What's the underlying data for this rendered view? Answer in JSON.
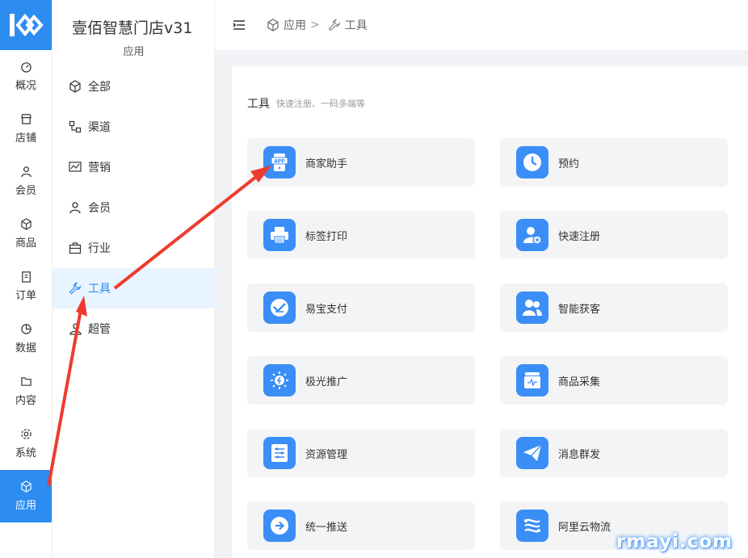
{
  "rail": {
    "items": [
      {
        "label": "概况",
        "icon": "dashboard-icon"
      },
      {
        "label": "店铺",
        "icon": "store-icon"
      },
      {
        "label": "会员",
        "icon": "user-icon"
      },
      {
        "label": "商品",
        "icon": "cube-icon"
      },
      {
        "label": "订单",
        "icon": "clipboard-icon"
      },
      {
        "label": "数据",
        "icon": "pie-icon"
      },
      {
        "label": "内容",
        "icon": "folder-icon"
      },
      {
        "label": "系统",
        "icon": "gear-icon"
      },
      {
        "label": "应用",
        "icon": "cube-icon"
      }
    ],
    "active": "应用"
  },
  "subnav": {
    "store_name": "壹佰智慧门店v31",
    "caption": "应用",
    "items": [
      {
        "label": "全部",
        "icon": "cube-icon"
      },
      {
        "label": "渠道",
        "icon": "channel-icon"
      },
      {
        "label": "营销",
        "icon": "chart-icon"
      },
      {
        "label": "会员",
        "icon": "user-icon"
      },
      {
        "label": "行业",
        "icon": "briefcase-icon"
      },
      {
        "label": "工具",
        "icon": "wrench-icon"
      },
      {
        "label": "超管",
        "icon": "admin-icon"
      }
    ],
    "active": "工具"
  },
  "breadcrumb": {
    "root": "应用",
    "separator": ">",
    "current": "工具"
  },
  "section": {
    "title": "工具",
    "description": "快速注册、一码多端等"
  },
  "tools": [
    {
      "label": "商家助手",
      "icon": "app-icon"
    },
    {
      "label": "预约",
      "icon": "clock-icon"
    },
    {
      "label": "标签打印",
      "icon": "printer-icon"
    },
    {
      "label": "快速注册",
      "icon": "user-add-icon"
    },
    {
      "label": "易宝支付",
      "icon": "pay-icon"
    },
    {
      "label": "智能获客",
      "icon": "users-icon"
    },
    {
      "label": "极光推广",
      "icon": "aurora-icon"
    },
    {
      "label": "商品采集",
      "icon": "collect-icon"
    },
    {
      "label": "资源管理",
      "icon": "resource-icon"
    },
    {
      "label": "消息群发",
      "icon": "send-icon"
    },
    {
      "label": "统一推送",
      "icon": "push-icon"
    },
    {
      "label": "阿里云物流",
      "icon": "logistics-icon"
    }
  ],
  "colors": {
    "accent": "#2d8cf0",
    "icon_bg": "#3a8ef6",
    "annotation_arrow": "#ee3b2f"
  },
  "watermark": "rmayi.com"
}
